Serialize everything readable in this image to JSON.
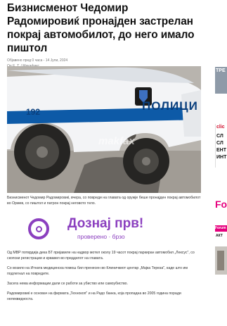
{
  "article": {
    "headline": "Бизнисменот Чедомир Радомировиќ пронајден застрелан покрај автомобилот, до него имало пиштол",
    "date": "Објавено пред 0 часа - 14 Јули, 2024",
    "author_prefix": "Од",
    "author": "Е. Т. / Мекафакс",
    "photo_car_number": "192",
    "photo_police_text": "ПОЛИЦИ",
    "photo_watermark": "makfax",
    "paragraphs": [
      "Бизнисменот Чедомир Радомировиќ, вчера, со повреди на главата од оружје беше пронајден покрај автомобилот во Ормев, со пиштол и патрон покрај неговото тело.",
      "Од МВР потврдија дека БТ пријавиле на надвор мотел околу 19 часот покрај паркиран автомобил „Лексус\", со скопски регистрации и крвавел во предделот на главата.",
      "Со возило на Итната медицинска помош бил пренесен во Клиничкиот центар „Мајка Тереза\", каде што им подлегнал на повредите.",
      "Засега нема информации дали се работи за убиство или самоубиство.",
      "Радомировиќ е основач на фирмата „Технокоп\" и на Радо банка, која пропадна во 2005 година поради нелеквидноста."
    ]
  },
  "ad": {
    "title": "Дознај прв!",
    "subtitle": "проверено · брзо"
  },
  "sidebar": {
    "fragments": [
      "ТРЕ",
      "clic",
      "СЛ",
      "СЛ",
      "ЕНТ",
      "ИНТ",
      "Fo",
      "Forum",
      "АКТ"
    ]
  }
}
